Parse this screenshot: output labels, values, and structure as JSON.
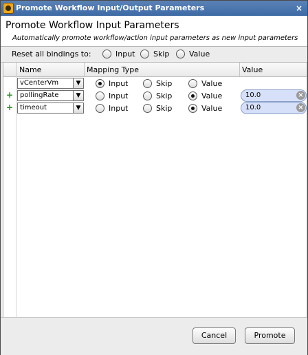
{
  "window": {
    "title": "Promote Workflow Input/Output Parameters",
    "close_glyph": "×"
  },
  "header": {
    "title": "Promote Workflow Input Parameters",
    "subtitle": "Automatically promote workflow/action input parameters as new input parameters"
  },
  "reset": {
    "label": "Reset all bindings to:",
    "options": [
      "Input",
      "Skip",
      "Value"
    ],
    "selected": null
  },
  "table": {
    "columns": [
      "Name",
      "Mapping Type",
      "Value"
    ],
    "mapping_options": [
      "Input",
      "Skip",
      "Value"
    ],
    "rows": [
      {
        "name": "vCenterVm",
        "mapping": "Input",
        "value": "",
        "show_plus": false
      },
      {
        "name": "pollingRate",
        "mapping": "Value",
        "value": "10.0",
        "show_plus": true
      },
      {
        "name": "timeout",
        "mapping": "Value",
        "value": "10.0",
        "show_plus": true
      }
    ]
  },
  "buttons": {
    "cancel": "Cancel",
    "promote": "Promote"
  },
  "icons": {
    "plus": "+",
    "dropdown": "▼",
    "clear": "×"
  }
}
